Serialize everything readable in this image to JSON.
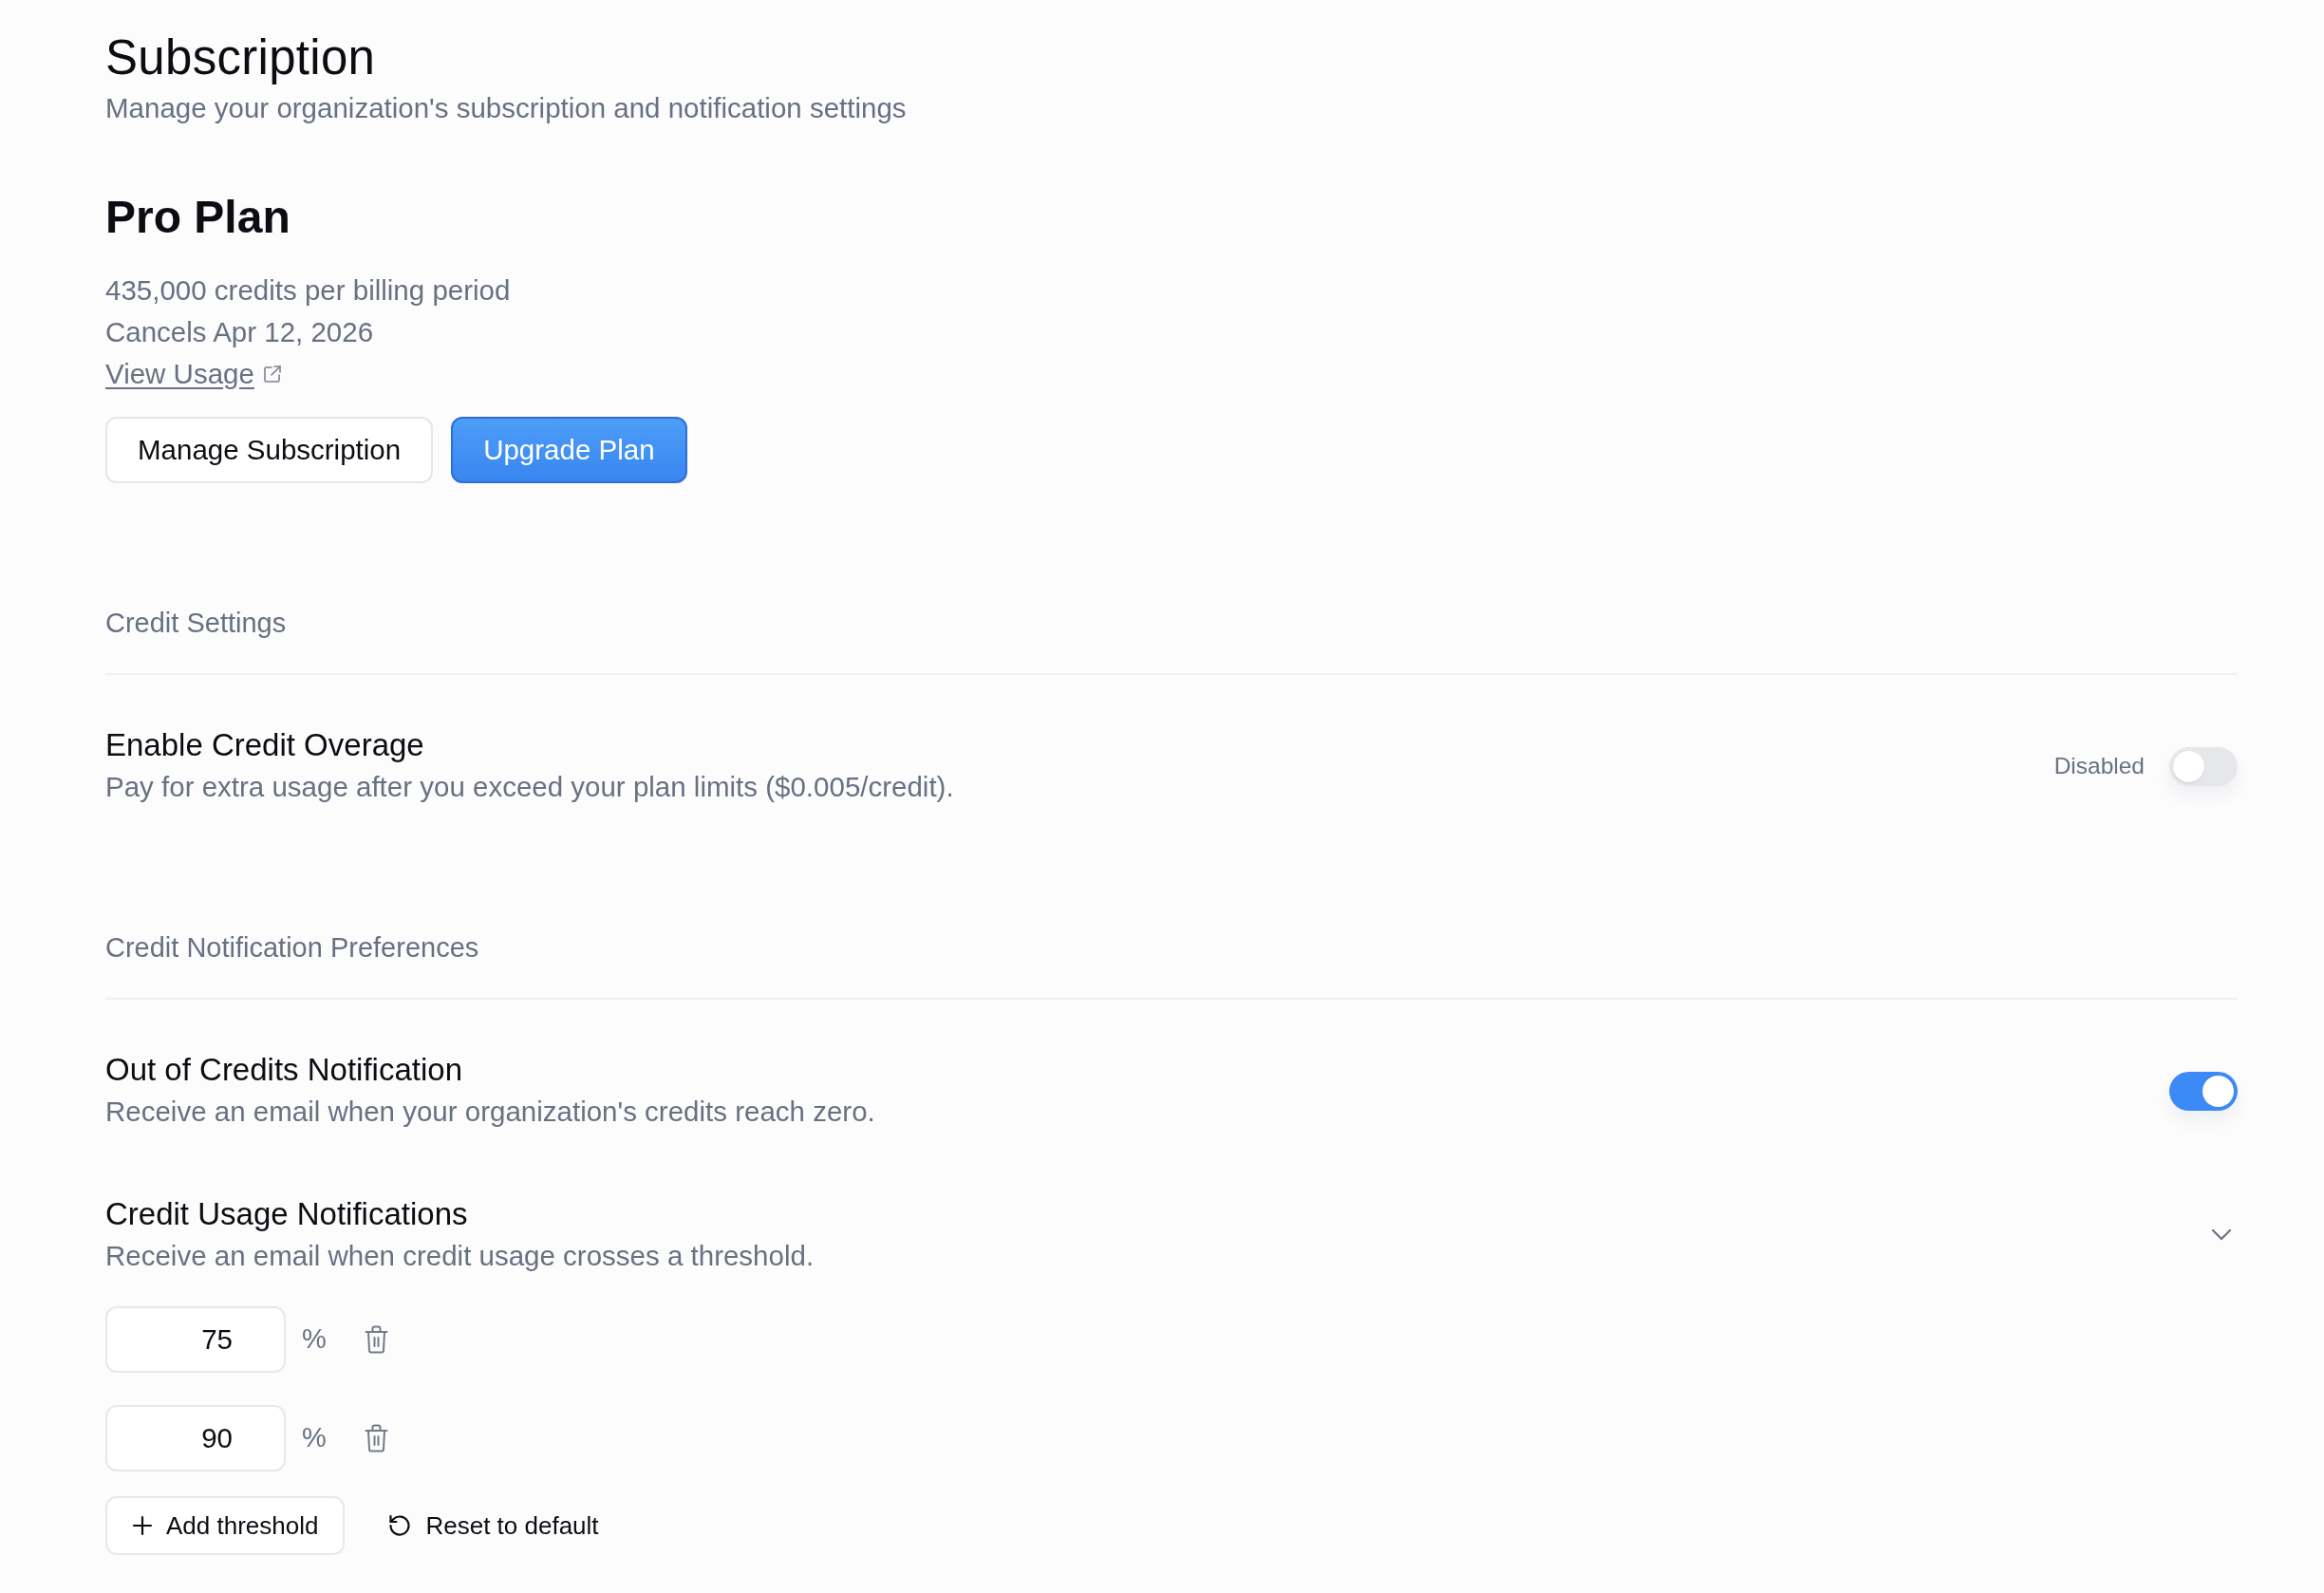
{
  "header": {
    "title": "Subscription",
    "subtitle": "Manage your organization's subscription and notification settings"
  },
  "plan": {
    "name": "Pro Plan",
    "details": [
      "435,000 credits per billing period",
      "Cancels Apr 12, 2026"
    ],
    "usage_link": "View Usage",
    "buttons": [
      {
        "label": "Manage Subscription",
        "kind": "secondary"
      },
      {
        "label": "Upgrade Plan",
        "kind": "primary"
      }
    ]
  },
  "sections": [
    {
      "title": "Credit Settings",
      "settings": [
        {
          "kind": "toggle",
          "title": "Enable Credit Overage",
          "description": "Pay for extra usage after you exceed your plan limits ($0.005/credit).",
          "status_label": "Disabled",
          "on": false
        }
      ]
    },
    {
      "title": "Credit Notification Preferences",
      "settings": [
        {
          "kind": "toggle",
          "title": "Out of Credits Notification",
          "description": "Receive an email when your organization's credits reach zero.",
          "on": true
        },
        {
          "kind": "thresholds",
          "title": "Credit Usage Notifications",
          "description": "Receive an email when credit usage crosses a threshold.",
          "expanded": true,
          "thresholds": [
            {
              "value": "75",
              "unit": "%"
            },
            {
              "value": "90",
              "unit": "%"
            }
          ],
          "actions": [
            {
              "label": "Add threshold",
              "kind": "add"
            },
            {
              "label": "Reset to default",
              "kind": "reset"
            }
          ]
        }
      ]
    }
  ]
}
